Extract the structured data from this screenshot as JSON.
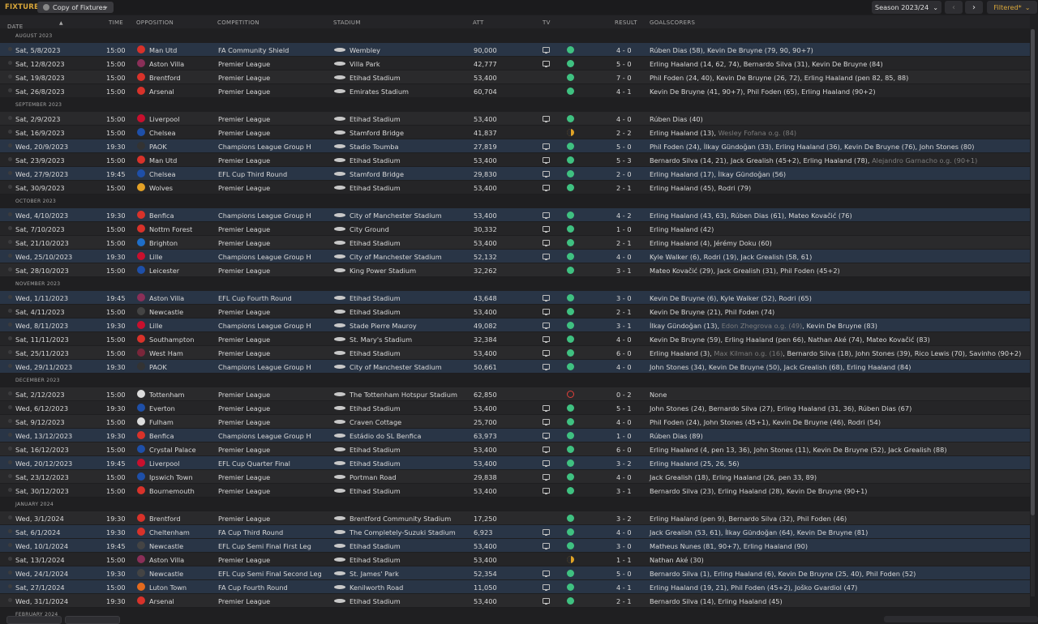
{
  "header": {
    "title": "FIXTURES",
    "view_label": "Copy of Fixtures",
    "season_label": "Season 2023/24",
    "filter_label": "Filtered*"
  },
  "columns": {
    "date": "DATE",
    "time": "TIME",
    "opposition": "OPPOSITION",
    "competition": "COMPETITION",
    "stadium": "STADIUM",
    "att": "ATT",
    "tv": "TV",
    "result": "RESULT",
    "goalscorers": "GOALSCORERS"
  },
  "rows": [
    {
      "type": "section",
      "label": "AUGUST 2023"
    },
    {
      "date": "Sat, 5/8/2023",
      "time": "15:00",
      "opp": "Man Utd",
      "crest": "#d8322a",
      "comp": "FA Community Shield",
      "stadium": "Wembley",
      "att": "90,000",
      "tv": true,
      "outcome": "w",
      "result": "4 - 0",
      "gs": [
        {
          "t": "Rúben Dias (58), Kevin De Bruyne (79, 90, 90+7)"
        }
      ],
      "hl": true
    },
    {
      "date": "Sat, 12/8/2023",
      "time": "15:00",
      "opp": "Aston Villa",
      "crest": "#8a2f58",
      "comp": "Premier League",
      "stadium": "Villa Park",
      "att": "42,777",
      "tv": true,
      "outcome": "w",
      "result": "5 - 0",
      "gs": [
        {
          "t": "Erling Haaland (14, 62, 74), Bernardo Silva (31), Kevin De Bruyne (84)"
        }
      ]
    },
    {
      "date": "Sat, 19/8/2023",
      "time": "15:00",
      "opp": "Brentford",
      "crest": "#d8322a",
      "comp": "Premier League",
      "stadium": "Etihad Stadium",
      "att": "53,400",
      "tv": false,
      "outcome": "w",
      "result": "7 - 0",
      "gs": [
        {
          "t": "Phil Foden (24, 40), Kevin De Bruyne (26, 72), Erling Haaland (pen 82, 85, 88)"
        }
      ]
    },
    {
      "date": "Sat, 26/8/2023",
      "time": "15:00",
      "opp": "Arsenal",
      "crest": "#d8322a",
      "comp": "Premier League",
      "stadium": "Emirates Stadium",
      "att": "60,704",
      "tv": false,
      "outcome": "w",
      "result": "4 - 1",
      "gs": [
        {
          "t": "Kevin De Bruyne (41, 90+7), Phil Foden (65), Erling Haaland (90+2)"
        }
      ]
    },
    {
      "type": "section",
      "label": "SEPTEMBER 2023"
    },
    {
      "date": "Sat, 2/9/2023",
      "time": "15:00",
      "opp": "Liverpool",
      "crest": "#c8102e",
      "comp": "Premier League",
      "stadium": "Etihad Stadium",
      "att": "53,400",
      "tv": true,
      "outcome": "w",
      "result": "4 - 0",
      "gs": [
        {
          "t": "Rúben Dias (40)"
        }
      ]
    },
    {
      "date": "Sat, 16/9/2023",
      "time": "15:00",
      "opp": "Chelsea",
      "crest": "#1e4fa8",
      "comp": "Premier League",
      "stadium": "Stamford Bridge",
      "att": "41,837",
      "tv": false,
      "outcome": "d",
      "result": "2 - 2",
      "gs": [
        {
          "t": "Erling Haaland (13), "
        },
        {
          "t": "Wesley Fofana o.g. (84)",
          "dim": true
        }
      ]
    },
    {
      "date": "Wed, 20/9/2023",
      "time": "19:30",
      "opp": "PAOK",
      "crest": "#333333",
      "comp": "Champions League Group H",
      "stadium": "Stadio Toumba",
      "att": "27,819",
      "tv": true,
      "outcome": "w",
      "result": "5 - 0",
      "gs": [
        {
          "t": "Phil Foden (24), İlkay Gündoğan (33), Erling Haaland (36), Kevin De Bruyne (76), John Stones (80)"
        }
      ],
      "hl": true
    },
    {
      "date": "Sat, 23/9/2023",
      "time": "15:00",
      "opp": "Man Utd",
      "crest": "#d8322a",
      "comp": "Premier League",
      "stadium": "Etihad Stadium",
      "att": "53,400",
      "tv": true,
      "outcome": "w",
      "result": "5 - 3",
      "gs": [
        {
          "t": "Bernardo Silva (14, 21), Jack Grealish (45+2), Erling Haaland (78), "
        },
        {
          "t": "Alejandro Garnacho o.g. (90+1)",
          "dim": true
        }
      ]
    },
    {
      "date": "Wed, 27/9/2023",
      "time": "19:45",
      "opp": "Chelsea",
      "crest": "#1e4fa8",
      "comp": "EFL Cup Third Round",
      "stadium": "Stamford Bridge",
      "att": "29,830",
      "tv": true,
      "outcome": "w",
      "result": "2 - 0",
      "gs": [
        {
          "t": "Erling Haaland (17), İlkay Gündoğan (56)"
        }
      ],
      "hl": true
    },
    {
      "date": "Sat, 30/9/2023",
      "time": "15:00",
      "opp": "Wolves",
      "crest": "#e3a126",
      "comp": "Premier League",
      "stadium": "Etihad Stadium",
      "att": "53,400",
      "tv": true,
      "outcome": "w",
      "result": "2 - 1",
      "gs": [
        {
          "t": "Erling Haaland (45), Rodri (79)"
        }
      ]
    },
    {
      "type": "section",
      "label": "OCTOBER 2023"
    },
    {
      "date": "Wed, 4/10/2023",
      "time": "19:30",
      "opp": "Benfica",
      "crest": "#d8322a",
      "comp": "Champions League Group H",
      "stadium": "City of Manchester Stadium",
      "att": "53,400",
      "tv": true,
      "outcome": "w",
      "result": "4 - 2",
      "gs": [
        {
          "t": "Erling Haaland (43, 63), Rúben Dias (61), Mateo Kovačić (76)"
        }
      ],
      "hl": true
    },
    {
      "date": "Sat, 7/10/2023",
      "time": "15:00",
      "opp": "Nottm Forest",
      "crest": "#d8322a",
      "comp": "Premier League",
      "stadium": "City Ground",
      "att": "30,332",
      "tv": true,
      "outcome": "w",
      "result": "1 - 0",
      "gs": [
        {
          "t": "Erling Haaland (42)"
        }
      ]
    },
    {
      "date": "Sat, 21/10/2023",
      "time": "15:00",
      "opp": "Brighton",
      "crest": "#1e6ec8",
      "comp": "Premier League",
      "stadium": "Etihad Stadium",
      "att": "53,400",
      "tv": true,
      "outcome": "w",
      "result": "2 - 1",
      "gs": [
        {
          "t": "Erling Haaland (4), Jérémy Doku (60)"
        }
      ]
    },
    {
      "date": "Wed, 25/10/2023",
      "time": "19:30",
      "opp": "Lille",
      "crest": "#c8102e",
      "comp": "Champions League Group H",
      "stadium": "City of Manchester Stadium",
      "att": "52,132",
      "tv": true,
      "outcome": "w",
      "result": "4 - 0",
      "gs": [
        {
          "t": "Kyle Walker (6), Rodri (19), Jack Grealish (58, 61)"
        }
      ],
      "hl": true
    },
    {
      "date": "Sat, 28/10/2023",
      "time": "15:00",
      "opp": "Leicester",
      "crest": "#1e4fa8",
      "comp": "Premier League",
      "stadium": "King Power Stadium",
      "att": "32,262",
      "tv": false,
      "outcome": "w",
      "result": "3 - 1",
      "gs": [
        {
          "t": "Mateo Kovačić (29), Jack Grealish (31), Phil Foden (45+2)"
        }
      ]
    },
    {
      "type": "section",
      "label": "NOVEMBER 2023"
    },
    {
      "date": "Wed, 1/11/2023",
      "time": "19:45",
      "opp": "Aston Villa",
      "crest": "#8a2f58",
      "comp": "EFL Cup Fourth Round",
      "stadium": "Etihad Stadium",
      "att": "43,648",
      "tv": true,
      "outcome": "w",
      "result": "3 - 0",
      "gs": [
        {
          "t": "Kevin De Bruyne (6), Kyle Walker (52), Rodri (65)"
        }
      ],
      "hl": true
    },
    {
      "date": "Sat, 4/11/2023",
      "time": "15:00",
      "opp": "Newcastle",
      "crest": "#444444",
      "comp": "Premier League",
      "stadium": "Etihad Stadium",
      "att": "53,400",
      "tv": true,
      "outcome": "w",
      "result": "2 - 1",
      "gs": [
        {
          "t": "Kevin De Bruyne (21), Phil Foden (74)"
        }
      ]
    },
    {
      "date": "Wed, 8/11/2023",
      "time": "19:30",
      "opp": "Lille",
      "crest": "#c8102e",
      "comp": "Champions League Group H",
      "stadium": "Stade Pierre Mauroy",
      "att": "49,082",
      "tv": true,
      "outcome": "w",
      "result": "3 - 1",
      "gs": [
        {
          "t": "İlkay Gündoğan (13), "
        },
        {
          "t": "Edon Zhegrova o.g. (49)",
          "dim": true
        },
        {
          "t": ", Kevin De Bruyne (83)"
        }
      ],
      "hl": true
    },
    {
      "date": "Sat, 11/11/2023",
      "time": "15:00",
      "opp": "Southampton",
      "crest": "#d8322a",
      "comp": "Premier League",
      "stadium": "St. Mary's Stadium",
      "att": "32,384",
      "tv": true,
      "outcome": "w",
      "result": "4 - 0",
      "gs": [
        {
          "t": "Kevin De Bruyne (59), Erling Haaland (pen 66), Nathan Aké (74), Mateo Kovačić (83)"
        }
      ]
    },
    {
      "date": "Sat, 25/11/2023",
      "time": "15:00",
      "opp": "West Ham",
      "crest": "#7a263a",
      "comp": "Premier League",
      "stadium": "Etihad Stadium",
      "att": "53,400",
      "tv": true,
      "outcome": "w",
      "result": "6 - 0",
      "gs": [
        {
          "t": "Erling Haaland (3), "
        },
        {
          "t": "Max Kilman o.g. (16)",
          "dim": true
        },
        {
          "t": ", Bernardo Silva (18), John Stones (39), Rico Lewis (70), Savinho (90+2)"
        }
      ]
    },
    {
      "date": "Wed, 29/11/2023",
      "time": "19:30",
      "opp": "PAOK",
      "crest": "#333333",
      "comp": "Champions League Group H",
      "stadium": "City of Manchester Stadium",
      "att": "50,661",
      "tv": true,
      "outcome": "w",
      "result": "4 - 0",
      "gs": [
        {
          "t": "John Stones (34), Kevin De Bruyne (50), Jack Grealish (68), Erling Haaland (84)"
        }
      ],
      "hl": true
    },
    {
      "type": "section",
      "label": "DECEMBER 2023"
    },
    {
      "date": "Sat, 2/12/2023",
      "time": "15:00",
      "opp": "Tottenham",
      "crest": "#dddddd",
      "comp": "Premier League",
      "stadium": "The Tottenham Hotspur Stadium",
      "att": "62,850",
      "tv": false,
      "outcome": "l",
      "result": "0 - 2",
      "gs": [
        {
          "t": "None"
        }
      ]
    },
    {
      "date": "Wed, 6/12/2023",
      "time": "19:30",
      "opp": "Everton",
      "crest": "#1e4fa8",
      "comp": "Premier League",
      "stadium": "Etihad Stadium",
      "att": "53,400",
      "tv": true,
      "outcome": "w",
      "result": "5 - 1",
      "gs": [
        {
          "t": "John Stones (24), Bernardo Silva (27), Erling Haaland (31, 36), Rúben Dias (67)"
        }
      ]
    },
    {
      "date": "Sat, 9/12/2023",
      "time": "15:00",
      "opp": "Fulham",
      "crest": "#dddddd",
      "comp": "Premier League",
      "stadium": "Craven Cottage",
      "att": "25,700",
      "tv": true,
      "outcome": "w",
      "result": "4 - 0",
      "gs": [
        {
          "t": "Phil Foden (24), John Stones (45+1), Kevin De Bruyne (46), Rodri (54)"
        }
      ]
    },
    {
      "date": "Wed, 13/12/2023",
      "time": "19:30",
      "opp": "Benfica",
      "crest": "#d8322a",
      "comp": "Champions League Group H",
      "stadium": "Estádio do SL Benfica",
      "att": "63,973",
      "tv": true,
      "outcome": "w",
      "result": "1 - 0",
      "gs": [
        {
          "t": "Rúben Dias (89)"
        }
      ],
      "hl": true
    },
    {
      "date": "Sat, 16/12/2023",
      "time": "15:00",
      "opp": "Crystal Palace",
      "crest": "#1e4fa8",
      "comp": "Premier League",
      "stadium": "Etihad Stadium",
      "att": "53,400",
      "tv": true,
      "outcome": "w",
      "result": "6 - 0",
      "gs": [
        {
          "t": "Erling Haaland (4, pen 13, 36), John Stones (11), Kevin De Bruyne (52), Jack Grealish (88)"
        }
      ]
    },
    {
      "date": "Wed, 20/12/2023",
      "time": "19:45",
      "opp": "Liverpool",
      "crest": "#c8102e",
      "comp": "EFL Cup Quarter Final",
      "stadium": "Etihad Stadium",
      "att": "53,400",
      "tv": true,
      "outcome": "w",
      "result": "3 - 2",
      "gs": [
        {
          "t": "Erling Haaland (25, 26, 56)"
        }
      ],
      "hl": true
    },
    {
      "date": "Sat, 23/12/2023",
      "time": "15:00",
      "opp": "Ipswich Town",
      "crest": "#1e4fa8",
      "comp": "Premier League",
      "stadium": "Portman Road",
      "att": "29,838",
      "tv": true,
      "outcome": "w",
      "result": "4 - 0",
      "gs": [
        {
          "t": "Jack Grealish (18), Erling Haaland (26, pen 33, 89)"
        }
      ]
    },
    {
      "date": "Sat, 30/12/2023",
      "time": "15:00",
      "opp": "Bournemouth",
      "crest": "#d8322a",
      "comp": "Premier League",
      "stadium": "Etihad Stadium",
      "att": "53,400",
      "tv": true,
      "outcome": "w",
      "result": "3 - 1",
      "gs": [
        {
          "t": "Bernardo Silva (23), Erling Haaland (28), Kevin De Bruyne (90+1)"
        }
      ]
    },
    {
      "type": "section",
      "label": "JANUARY 2024"
    },
    {
      "date": "Wed, 3/1/2024",
      "time": "19:30",
      "opp": "Brentford",
      "crest": "#d8322a",
      "comp": "Premier League",
      "stadium": "Brentford Community Stadium",
      "att": "17,250",
      "tv": false,
      "outcome": "w",
      "result": "3 - 2",
      "gs": [
        {
          "t": "Erling Haaland (pen 9), Bernardo Silva (32), Phil Foden (46)"
        }
      ]
    },
    {
      "date": "Sat, 6/1/2024",
      "time": "19:30",
      "opp": "Cheltenham",
      "crest": "#d8322a",
      "comp": "FA Cup Third Round",
      "stadium": "The Completely-Suzuki Stadium",
      "att": "6,923",
      "tv": true,
      "outcome": "w",
      "result": "4 - 0",
      "gs": [
        {
          "t": "Jack Grealish (53, 61), İlkay Gündoğan (64), Kevin De Bruyne (81)"
        }
      ],
      "hl": true
    },
    {
      "date": "Wed, 10/1/2024",
      "time": "19:45",
      "opp": "Newcastle",
      "crest": "#444444",
      "comp": "EFL Cup Semi Final First Leg",
      "stadium": "Etihad Stadium",
      "att": "53,400",
      "tv": true,
      "outcome": "w",
      "result": "3 - 0",
      "gs": [
        {
          "t": "Matheus Nunes (81, 90+7), Erling Haaland (90)"
        }
      ],
      "hl": true
    },
    {
      "date": "Sat, 13/1/2024",
      "time": "15:00",
      "opp": "Aston Villa",
      "crest": "#8a2f58",
      "comp": "Premier League",
      "stadium": "Etihad Stadium",
      "att": "53,400",
      "tv": false,
      "outcome": "d",
      "result": "1 - 1",
      "gs": [
        {
          "t": "Nathan Aké (30)"
        }
      ]
    },
    {
      "date": "Wed, 24/1/2024",
      "time": "19:30",
      "opp": "Newcastle",
      "crest": "#444444",
      "comp": "EFL Cup Semi Final Second Leg",
      "stadium": "St. James' Park",
      "att": "52,354",
      "tv": true,
      "outcome": "w",
      "result": "5 - 0",
      "gs": [
        {
          "t": "Bernardo Silva (1), Erling Haaland (6), Kevin De Bruyne (25, 40), Phil Foden (52)"
        }
      ],
      "hl": true
    },
    {
      "date": "Sat, 27/1/2024",
      "time": "15:00",
      "opp": "Luton Town",
      "crest": "#e36a1e",
      "comp": "FA Cup Fourth Round",
      "stadium": "Kenilworth Road",
      "att": "11,050",
      "tv": true,
      "outcome": "w",
      "result": "4 - 1",
      "gs": [
        {
          "t": "Erling Haaland (19, 21), Phil Foden (45+2), Joško Gvardiol (47)"
        }
      ],
      "hl": true
    },
    {
      "date": "Wed, 31/1/2024",
      "time": "19:30",
      "opp": "Arsenal",
      "crest": "#d8322a",
      "comp": "Premier League",
      "stadium": "Etihad Stadium",
      "att": "53,400",
      "tv": true,
      "outcome": "w",
      "result": "2 - 1",
      "gs": [
        {
          "t": "Bernardo Silva (14), Erling Haaland (45)"
        }
      ]
    },
    {
      "type": "section",
      "label": "FEBRUARY 2024"
    }
  ]
}
